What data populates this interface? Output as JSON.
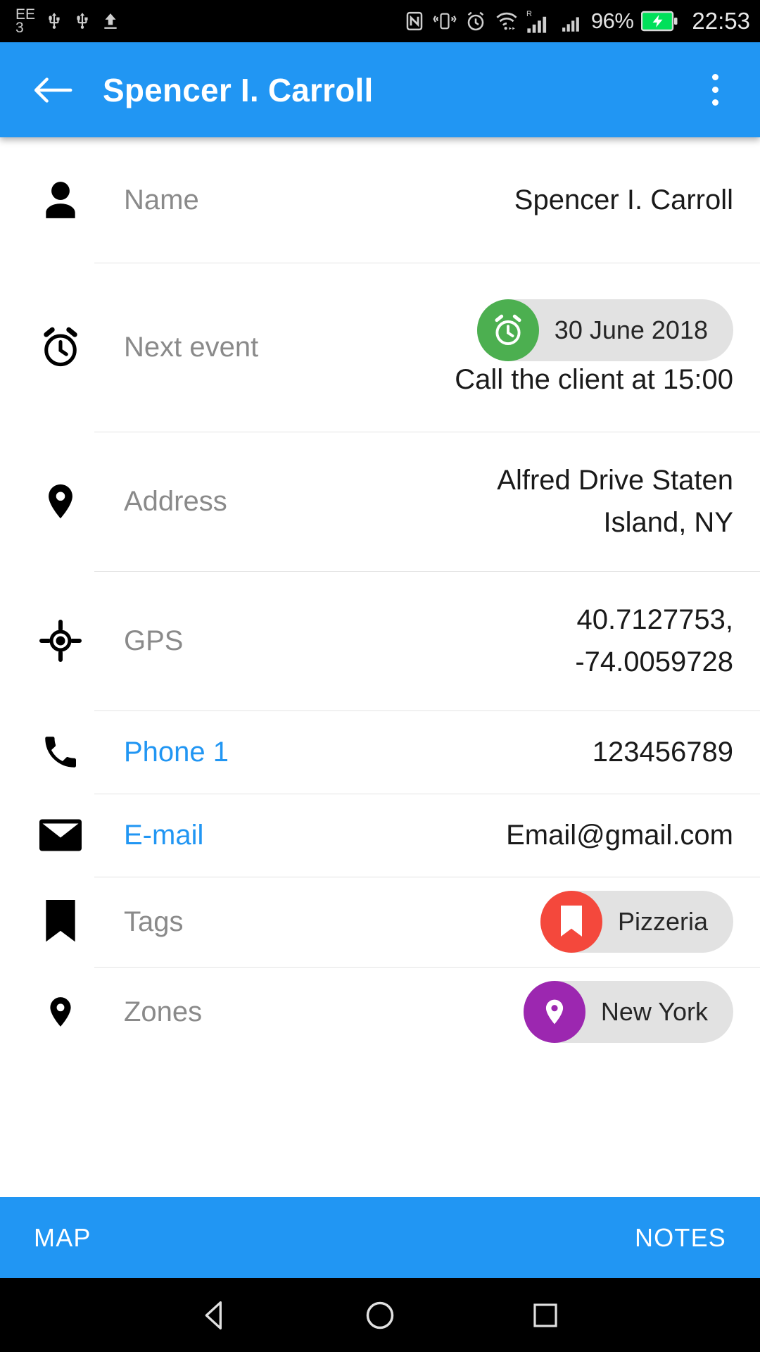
{
  "status_bar": {
    "carrier_line1": "EE",
    "carrier_line2": "3",
    "icons_left": [
      "usb-icon",
      "usb-icon",
      "upload-icon"
    ],
    "icons_right": [
      "nfc-icon",
      "vibrate-icon",
      "alarm-icon",
      "wifi-icon",
      "signal-roaming-icon",
      "signal-icon"
    ],
    "battery_percent": "96%",
    "battery_state": "charging",
    "time": "22:53"
  },
  "app_bar": {
    "back_icon": "arrow-left-icon",
    "title": "Spencer I. Carroll",
    "overflow_icon": "more-vertical-icon",
    "background": "#2196f3"
  },
  "details": {
    "rows": [
      {
        "key": "name",
        "icon": "person-icon",
        "label": "Name",
        "label_is_link": false,
        "value_lines": [
          "Spencer I. Carroll"
        ]
      },
      {
        "key": "next_event",
        "icon": "alarm-icon",
        "label": "Next event",
        "label_is_link": false,
        "chip": {
          "text": "30 June 2018",
          "avatar_icon": "alarm-icon",
          "avatar_color": "#4caf50",
          "background": "#e2e2e2"
        },
        "value_lines": [
          "Call the client at 15:00"
        ]
      },
      {
        "key": "address",
        "icon": "location-pin-icon",
        "label": "Address",
        "label_is_link": false,
        "value_lines": [
          "Alfred Drive Staten",
          "Island, NY"
        ]
      },
      {
        "key": "gps",
        "icon": "gps-crosshair-icon",
        "label": "GPS",
        "label_is_link": false,
        "value_lines": [
          "40.7127753,",
          "-74.0059728"
        ]
      },
      {
        "key": "phone",
        "icon": "phone-icon",
        "label": "Phone 1",
        "label_is_link": true,
        "value_lines": [
          "123456789"
        ]
      },
      {
        "key": "email",
        "icon": "envelope-icon",
        "label": "E-mail",
        "label_is_link": true,
        "value_lines": [
          "Email@gmail.com"
        ]
      },
      {
        "key": "tags",
        "icon": "bookmark-icon",
        "label": "Tags",
        "label_is_link": false,
        "chip": {
          "text": "Pizzeria",
          "avatar_icon": "bookmark-icon",
          "avatar_color": "#f4483c",
          "background": "#e2e2e2"
        }
      },
      {
        "key": "zones",
        "icon": "location-pin-icon",
        "label": "Zones",
        "label_is_link": false,
        "chip": {
          "text": "New York",
          "avatar_icon": "location-pin-icon",
          "avatar_color": "#9c27b0",
          "background": "#e2e2e2"
        }
      }
    ]
  },
  "bottom_bar": {
    "left_button": "MAP",
    "right_button": "NOTES",
    "background": "#2196f3"
  },
  "nav_bar": {
    "back_icon": "triangle-back-icon",
    "home_icon": "circle-home-icon",
    "recents_icon": "square-recents-icon"
  },
  "colors": {
    "accent": "#2196f3",
    "link": "#2196f3",
    "label": "#8a8a8a",
    "value": "#1a1a1a",
    "divider": "#e3e3e3"
  }
}
